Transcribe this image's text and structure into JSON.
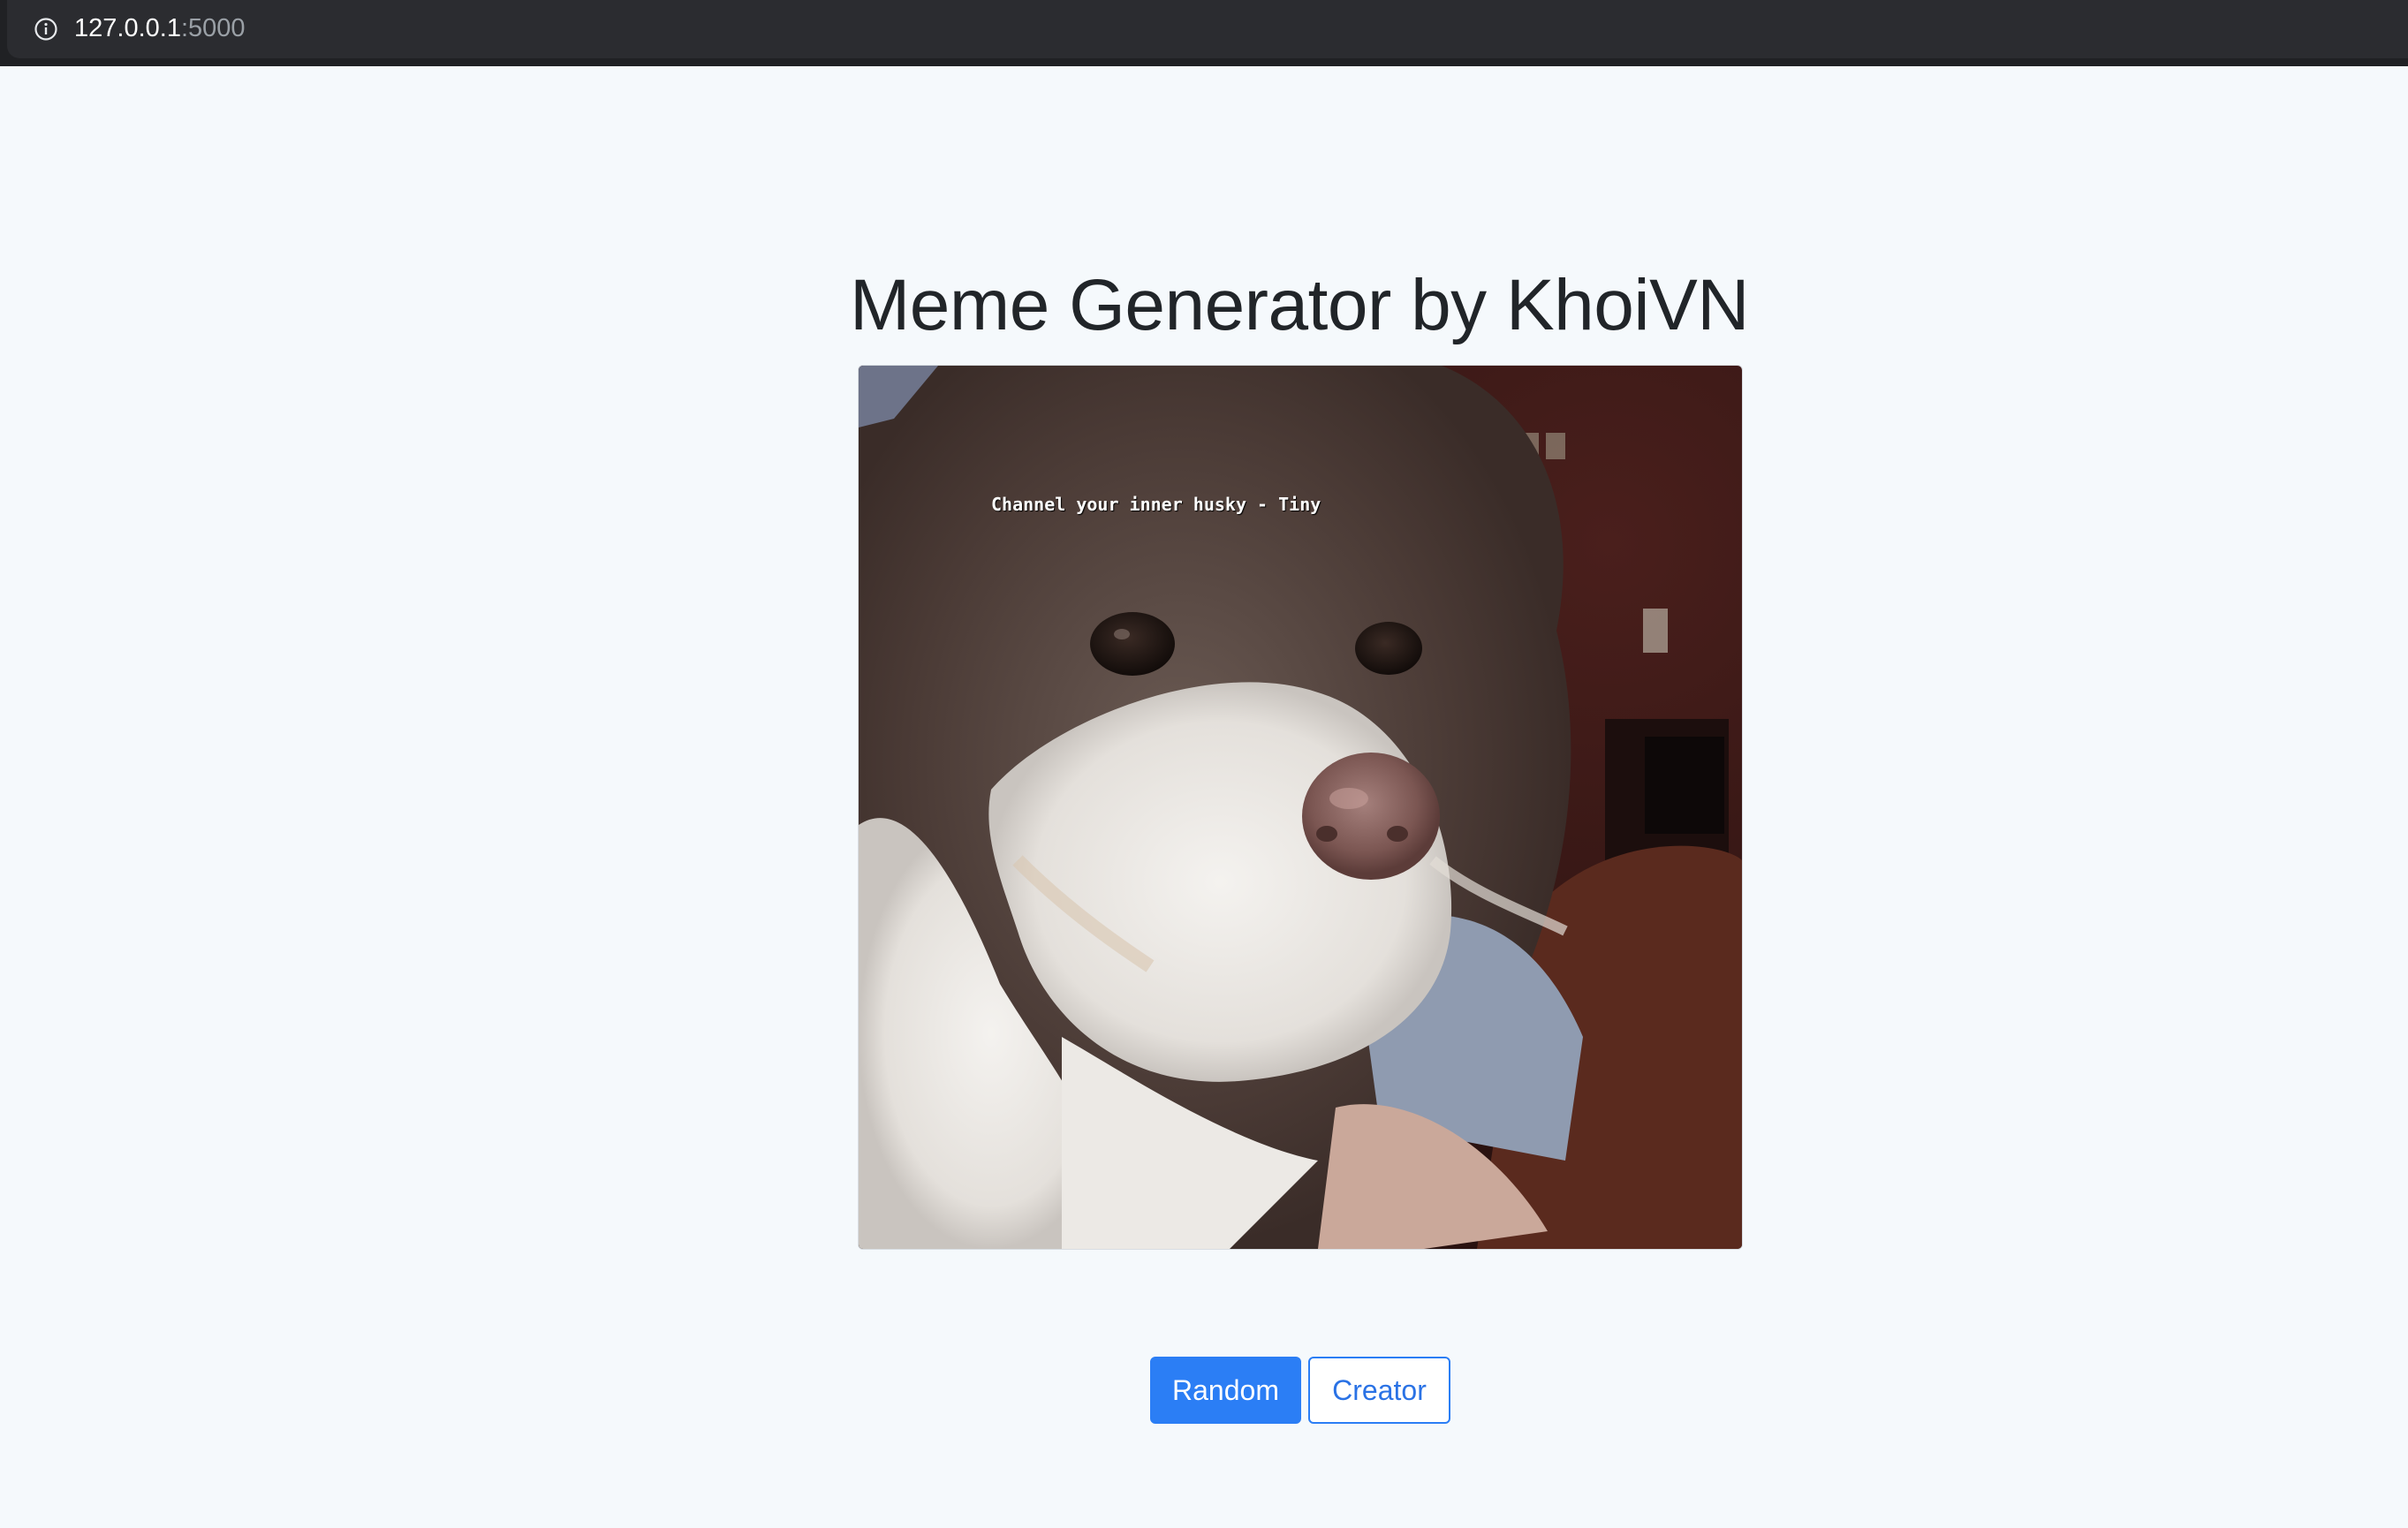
{
  "browser": {
    "url_host": "127.0.0.1",
    "url_port": ":5000",
    "icon": "info-icon"
  },
  "page": {
    "title": "Meme Generator by KhoiVN"
  },
  "meme": {
    "caption": "Channel your inner husky - Tiny",
    "image_subject": "dog-photo"
  },
  "buttons": {
    "random_label": "Random",
    "creator_label": "Creator"
  },
  "colors": {
    "primary": "#2b7ef5",
    "background": "#f5f9fc",
    "title": "#212529"
  }
}
